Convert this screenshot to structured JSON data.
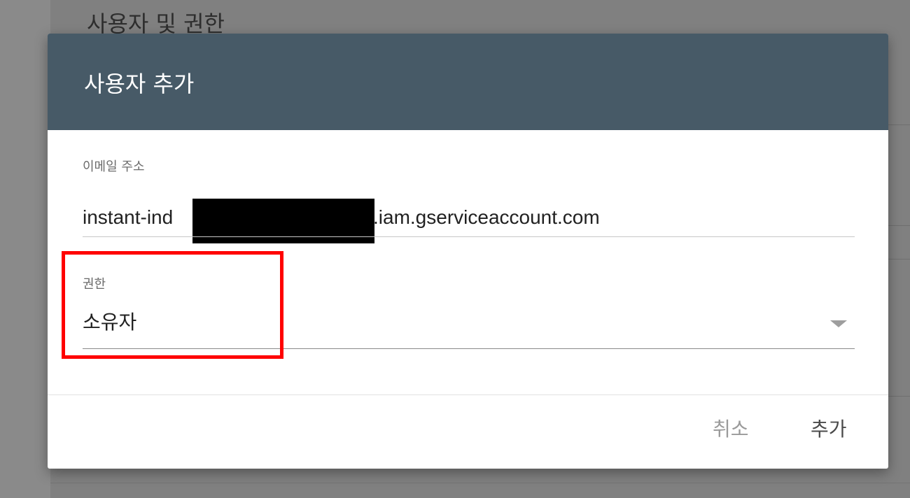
{
  "background": {
    "heading": "사용자 및 권한"
  },
  "dialog": {
    "title": "사용자 추가",
    "email_field": {
      "label": "이메일 주소",
      "value_prefix": "instant-ind",
      "value_suffix": ".iam.gserviceaccount.com"
    },
    "permission_field": {
      "label": "권한",
      "selected": "소유자"
    },
    "actions": {
      "cancel_label": "취소",
      "add_label": "추가"
    }
  },
  "colors": {
    "header_bg": "#475a67",
    "highlight": "#ff0000",
    "overlay": "#7f7f7f"
  },
  "icons": {
    "dropdown": "dropdown-arrow-icon"
  }
}
